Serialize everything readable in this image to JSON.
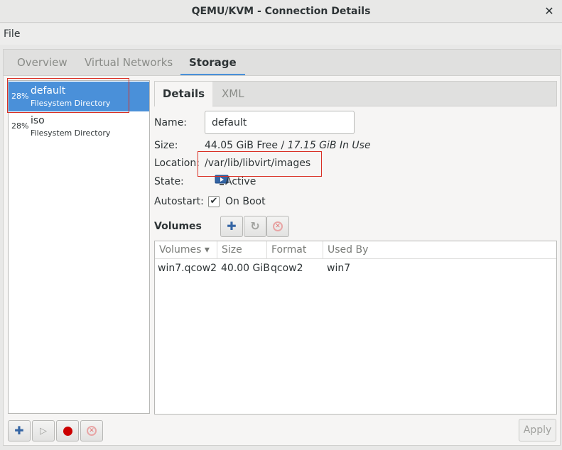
{
  "window": {
    "title": "QEMU/KVM - Connection Details",
    "close_glyph": "✕"
  },
  "menu": {
    "file": "File"
  },
  "tabs": [
    {
      "label": "Overview"
    },
    {
      "label": "Virtual Networks"
    },
    {
      "label": "Storage"
    }
  ],
  "active_tab": "Storage",
  "pools": [
    {
      "percent": "28%",
      "name": "default",
      "type": "Filesystem Directory",
      "selected": true
    },
    {
      "percent": "28%",
      "name": "iso",
      "type": "Filesystem Directory",
      "selected": false
    }
  ],
  "subtabs": [
    {
      "label": "Details"
    },
    {
      "label": "XML"
    }
  ],
  "details": {
    "name_label": "Name:",
    "name_value": "default",
    "size_label": "Size:",
    "size_free": "44.05 GiB Free / ",
    "size_in_use": "17.15 GiB In Use",
    "location_label": "Location:",
    "location_value": "/var/lib/libvirt/images",
    "state_label": "State:",
    "state_value": "Active",
    "autostart_label": "Autostart:",
    "autostart_value": "On Boot",
    "autostart_checked_glyph": "✔"
  },
  "volumes": {
    "label": "Volumes",
    "columns": [
      "Volumes",
      "Size",
      "Format",
      "Used By"
    ],
    "sort_glyph": "▾",
    "rows": [
      {
        "name": "win7.qcow2",
        "size": "40.00 GiB",
        "format": "qcow2",
        "used_by": "win7"
      }
    ]
  },
  "icons": {
    "add": "plus-icon",
    "refresh": "refresh-icon",
    "delete": "delete-icon",
    "start": "play-icon",
    "stop": "record-icon"
  },
  "glyphs": {
    "plus": "✚",
    "refresh": "↻",
    "x": "✕",
    "play": "▷"
  },
  "apply_label": "Apply",
  "colors": {
    "accent": "#4a90d9",
    "highlight_box": "#d93025",
    "record": "#cc0000"
  }
}
